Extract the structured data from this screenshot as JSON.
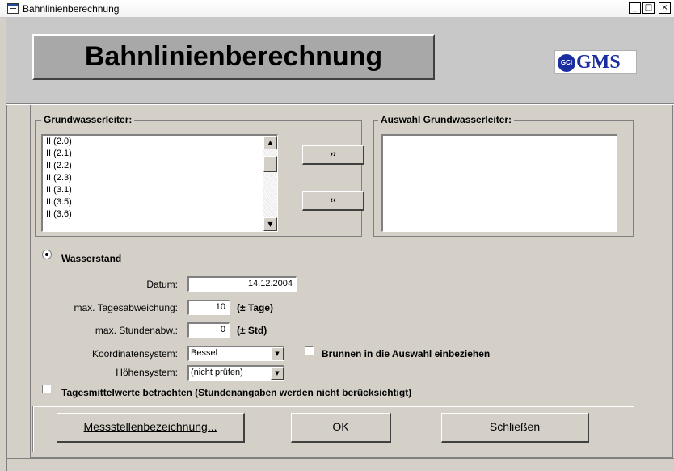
{
  "window": {
    "title": "Bahnlinienberechnung",
    "minimize": "_",
    "maximize": "□",
    "close": "×"
  },
  "header": {
    "banner_title": "Bahnlinienberechnung",
    "logo_mark": "GCI",
    "logo_text": "GMS"
  },
  "grundwasserleiter": {
    "legend": "Grundwasserleiter:",
    "items": [
      "II (2.0)",
      "II (2.1)",
      "II (2.2)",
      "II (2.3)",
      "II (3.1)",
      "II (3.5)",
      "II (3.6)"
    ]
  },
  "auswahl": {
    "legend": "Auswahl Grundwasserleiter:",
    "items": []
  },
  "transfer": {
    "add_label": "››",
    "remove_label": "‹‹"
  },
  "options": {
    "wasserstand_label": "Wasserstand",
    "wasserstand_selected": true,
    "datum_label": "Datum:",
    "datum_value": "14.12.2004",
    "tagesabweichung_label": "max. Tagesabweichung:",
    "tagesabweichung_value": "10",
    "tagesabweichung_unit": "(± Tage)",
    "stundenabw_label": "max. Stundenabw.:",
    "stundenabw_value": "0",
    "stundenabw_unit": "(± Std)",
    "koordinatensystem_label": "Koordinatensystem:",
    "koordinatensystem_value": "Bessel",
    "hoehensystem_label": "Höhensystem:",
    "hoehensystem_value": "(nicht prüfen)",
    "brunnen_label": "Brunnen in die Auswahl einbeziehen",
    "brunnen_checked": false,
    "tagesmittel_label": "Tagesmittelwerte betrachten (Stundenangaben werden nicht berücksichtigt)",
    "tagesmittel_checked": false
  },
  "buttons": {
    "messstellen_label": "Messstellenbezeichnung...",
    "ok_label": "OK",
    "schliessen_label": "Schließen"
  },
  "icons": {
    "app": "form-window-icon",
    "dropdown": "chevron-down-icon",
    "scroll_up": "arrow-up-icon",
    "scroll_down": "arrow-down-icon"
  },
  "colors": {
    "face": "#d4d0c8",
    "banner": "#a8a8a8",
    "logo_blue": "#1a2ea0"
  }
}
